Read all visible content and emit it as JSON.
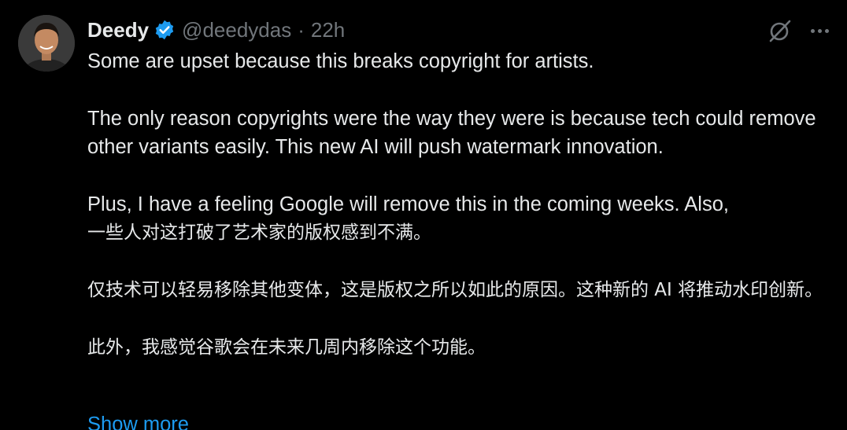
{
  "author": {
    "name": "Deedy",
    "handle": "@deedydas",
    "separator": "·",
    "time": "22h",
    "verified": true,
    "verified_color": "#1d9bf0"
  },
  "icons": {
    "grok": "grok-icon",
    "more": "more-options-icon",
    "verified": "verified-badge-icon"
  },
  "tweet": {
    "paragraphs": [
      "Some are upset because this breaks copyright for artists.",
      "The only reason copyrights were the way they were is because tech could remove other variants easily. This new AI will push watermark innovation.",
      "Plus, I have a feeling Google will remove this in the coming weeks. Also,",
      "一些人对这打破了艺术家的版权感到不满。",
      "仅技术可以轻易移除其他变体，这是版权之所以如此的原因。这种新的 AI 将推动水印创新。",
      "此外，我感觉谷歌会在未来几周内移除这个功能。"
    ],
    "show_more": "Show more"
  },
  "colors": {
    "background": "#000000",
    "text": "#e7e9ea",
    "muted": "#71767b",
    "link": "#1d9bf0"
  }
}
